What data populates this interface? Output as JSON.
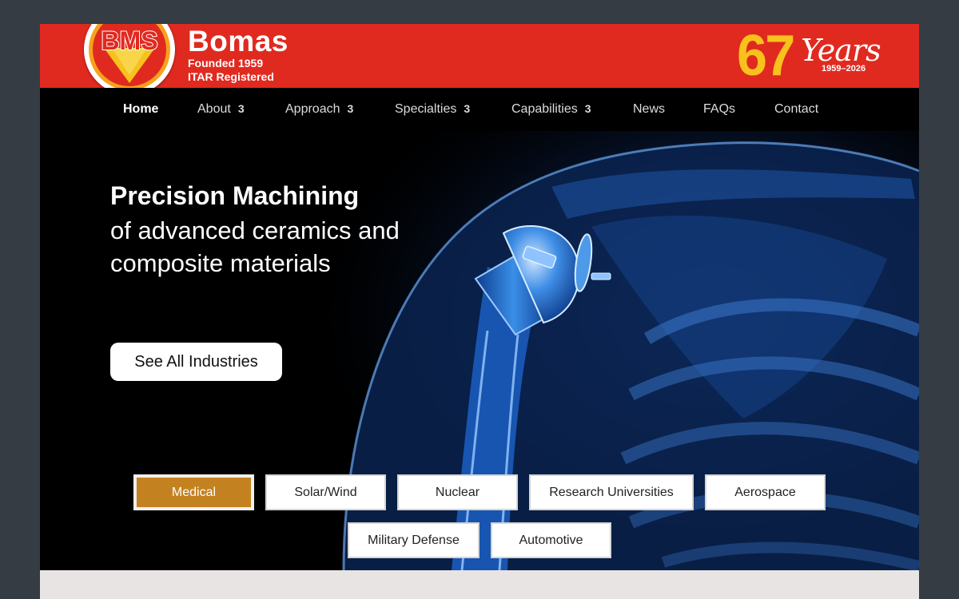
{
  "header": {
    "logo_text": "BMS",
    "brand_name": "Bomas",
    "tagline_1": "Founded 1959",
    "tagline_2": "ITAR Registered",
    "anniversary": {
      "number": "67",
      "word": "Years",
      "range": "1959–2026"
    }
  },
  "nav": {
    "items": [
      {
        "label": "Home",
        "caret": ""
      },
      {
        "label": "About",
        "caret": "3"
      },
      {
        "label": "Approach",
        "caret": "3"
      },
      {
        "label": "Specialties",
        "caret": "3"
      },
      {
        "label": "Capabilities",
        "caret": "3"
      },
      {
        "label": "News",
        "caret": ""
      },
      {
        "label": "FAQs",
        "caret": ""
      },
      {
        "label": "Contact",
        "caret": ""
      }
    ],
    "active": "Home"
  },
  "hero": {
    "title": "Precision Machining",
    "subtitle": "of advanced ceramics and composite materials",
    "cta_label": "See All Industries"
  },
  "industries": {
    "items": [
      "Medical",
      "Solar/Wind",
      "Nuclear",
      "Research Universities",
      "Aerospace",
      "Military Defense",
      "Automotive"
    ],
    "selected": "Medical"
  },
  "colors": {
    "header_red": "#e02a20",
    "anniversary_yellow": "#f7c21c",
    "selected_tab": "#c3821f",
    "page_background": "#353c44"
  }
}
